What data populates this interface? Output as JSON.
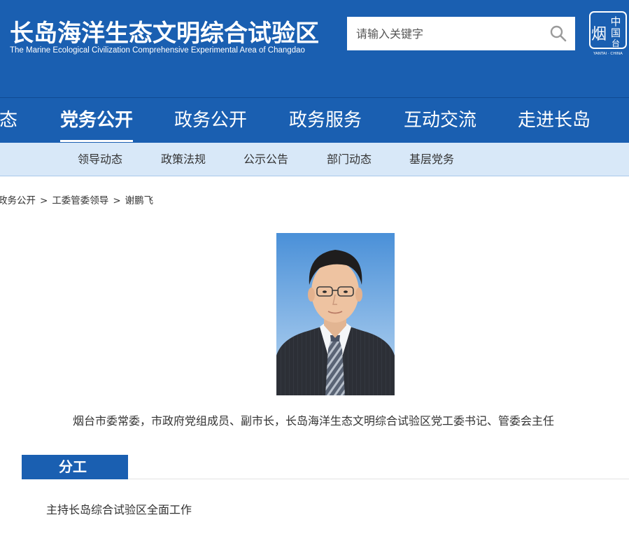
{
  "header": {
    "site_title": "长岛海洋生态文明综合试验区",
    "site_subtitle": "The Marine Ecological Civilization Comprehensive Experimental Area of Changdao",
    "search": {
      "placeholder": "请输入关键字",
      "value": ""
    },
    "seal": {
      "char_main": "烟",
      "char_top": "中",
      "char_mid": "国",
      "char_bottom": "台",
      "caption": "YANTAI · CHINA"
    }
  },
  "nav": {
    "items": [
      {
        "label": "态"
      },
      {
        "label": "党务公开"
      },
      {
        "label": "政务公开"
      },
      {
        "label": "政务服务"
      },
      {
        "label": "互动交流"
      },
      {
        "label": "走进长岛"
      }
    ],
    "active_index": 1
  },
  "subnav": {
    "items": [
      {
        "label": "领导动态"
      },
      {
        "label": "政策法规"
      },
      {
        "label": "公示公告"
      },
      {
        "label": "部门动态"
      },
      {
        "label": "基层党务"
      }
    ]
  },
  "breadcrumb": {
    "items": [
      {
        "label": "政务公开"
      },
      {
        "label": "工委管委领导"
      },
      {
        "label": "谢鹏飞"
      }
    ],
    "separator": ">"
  },
  "profile": {
    "caption": "烟台市委常委，市政府党组成员、副市长，长岛海洋生态文明综合试验区党工委书记、管委会主任",
    "section_title": "分工",
    "duty": "主持长岛综合试验区全面工作"
  },
  "colors": {
    "brand_blue": "#1a5fb1",
    "subnav_bg": "#d8e8f8"
  }
}
